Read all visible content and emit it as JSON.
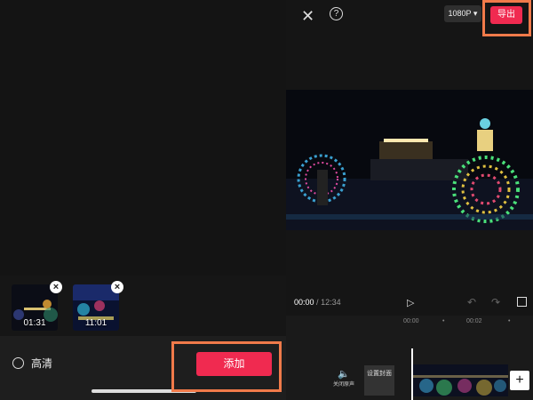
{
  "left_panel": {
    "thumbnails": [
      {
        "duration": "01:31"
      },
      {
        "duration": "11:01"
      }
    ],
    "quality_label": "高清",
    "add_button_label": "添加"
  },
  "top_bar": {
    "resolution_label": "1080P",
    "export_label": "导出"
  },
  "playback": {
    "current_time": "00:00",
    "separator": "/",
    "total_time": "12:34"
  },
  "timeline": {
    "ruler": [
      "00:00",
      "00:02"
    ],
    "mute_label": "关闭原声",
    "cover_label": "设置封面"
  },
  "colors": {
    "accent": "#f02a50",
    "highlight": "#f07a4a"
  }
}
